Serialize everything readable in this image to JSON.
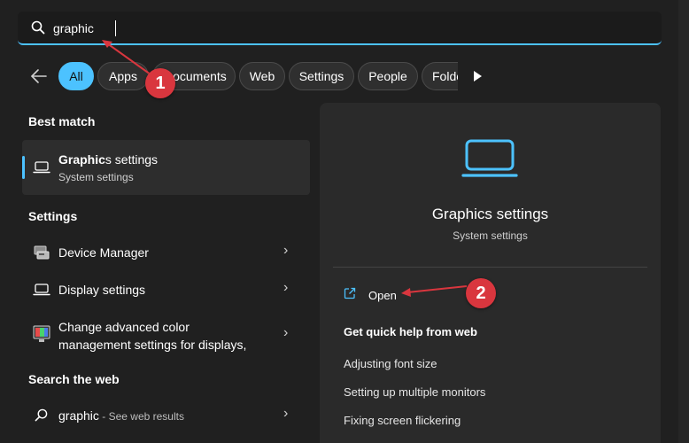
{
  "search": {
    "query": "graphic"
  },
  "filters": [
    {
      "label": "All",
      "active": true
    },
    {
      "label": "Apps"
    },
    {
      "label": "Documents"
    },
    {
      "label": "Web"
    },
    {
      "label": "Settings"
    },
    {
      "label": "People"
    },
    {
      "label": "Folders"
    }
  ],
  "best_match": {
    "heading": "Best match",
    "title_bold": "Graphic",
    "title_rest": "s settings",
    "subtitle": "System settings",
    "icon": "laptop-icon"
  },
  "settings_section": {
    "heading": "Settings",
    "items": [
      {
        "label": "Device Manager",
        "icon": "device-manager-icon"
      },
      {
        "label": "Display settings",
        "icon": "display-icon"
      },
      {
        "label_line1": "Change advanced color",
        "label_line2": "management settings for displays,",
        "icon": "color-management-icon"
      }
    ]
  },
  "web_section": {
    "heading": "Search the web",
    "query": "graphic",
    "suffix": " - See web results"
  },
  "preview": {
    "title": "Graphics settings",
    "subtitle": "System settings",
    "open_label": "Open",
    "help_heading": "Get quick help from web",
    "help_links": [
      "Adjusting font size",
      "Setting up multiple monitors",
      "Fixing screen flickering"
    ]
  },
  "annotations": {
    "badge1": "1",
    "badge2": "2"
  },
  "colors": {
    "accent": "#4cc2ff",
    "callout": "#d9363e",
    "background": "#202020"
  }
}
